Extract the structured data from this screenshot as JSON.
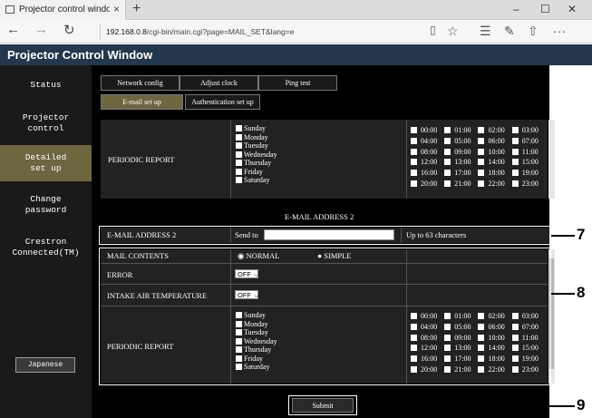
{
  "browser": {
    "tab_title": "Projector control windo",
    "tab_close": "×",
    "new_tab": "+",
    "minimize": "–",
    "maximize": "☐",
    "close": "✕",
    "back": "←",
    "forward": "→",
    "refresh": "↻",
    "url_host": "192.168.0.8",
    "url_path": "/cgi-bin/main.cgi?page=MAIL_SET&lang=e",
    "toolbar_icons": [
      "reading-view-icon",
      "favorite-star-icon",
      "hub-icon",
      "notes-icon",
      "share-icon",
      "more-icon"
    ]
  },
  "app": {
    "title": "Projector Control Window"
  },
  "sidebar": {
    "items": [
      {
        "label": "Status"
      },
      {
        "label": "Projector\ncontrol"
      },
      {
        "label": "Detailed\nset up",
        "active": true
      },
      {
        "label": "Change\npassword"
      },
      {
        "label": "Crestron\nConnected(TM)"
      }
    ],
    "language_button": "Japanese"
  },
  "tabs": {
    "row1": [
      "Network config",
      "Adjust clock",
      "Ping test"
    ],
    "row2": [
      {
        "label": "E-mail set up",
        "active": true
      },
      {
        "label": "Authentication set up"
      }
    ]
  },
  "days": [
    "Sunday",
    "Monday",
    "Tuesday",
    "Wednesday",
    "Thursday",
    "Friday",
    "Saturday"
  ],
  "hours": [
    [
      "00:00",
      "01:00",
      "02:00",
      "03:00"
    ],
    [
      "04:00",
      "05:00",
      "06:00",
      "07:00"
    ],
    [
      "08:00",
      "09:00",
      "10:00",
      "11:00"
    ],
    [
      "12:00",
      "13:00",
      "14:00",
      "15:00"
    ],
    [
      "16:00",
      "17:00",
      "18:00",
      "19:00"
    ],
    [
      "20:00",
      "21:00",
      "22:00",
      "23:00"
    ]
  ],
  "top_section": {
    "periodic_report_label": "PERIODIC REPORT"
  },
  "address2": {
    "heading": "E-MAIL ADDRESS 2",
    "label": "E-MAIL ADDRESS 2",
    "send_to": "Send to",
    "value": "",
    "limit": "Up to 63 characters"
  },
  "settings": {
    "mail_contents_label": "MAIL CONTENTS",
    "normal_label": "NORMAL",
    "simple_label": "SIMPLE",
    "selected": "NORMAL",
    "error_label": "ERROR",
    "error_value": "OFF",
    "intake_label": "INTAKE AIR TEMPERATURE",
    "intake_value": "OFF",
    "periodic_report_label": "PERIODIC REPORT"
  },
  "submit_label": "Submit",
  "callouts": [
    "7",
    "8",
    "9"
  ]
}
